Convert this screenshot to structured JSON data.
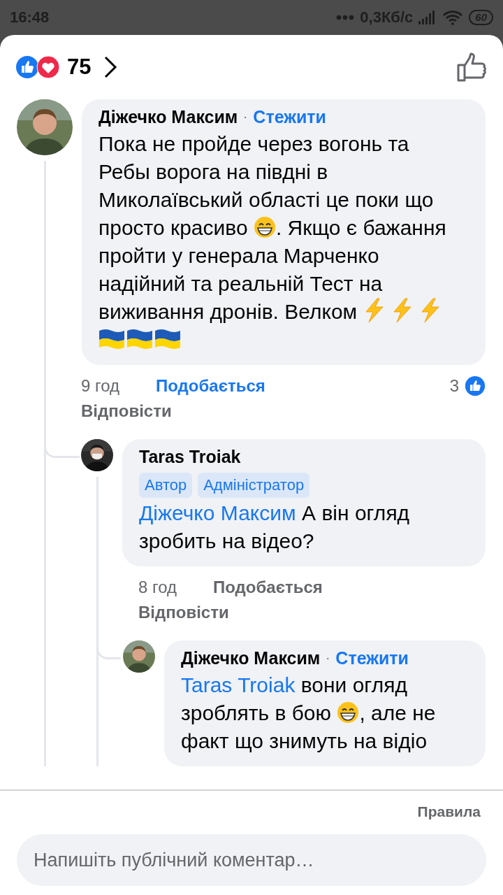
{
  "status_bar": {
    "time": "16:48",
    "net_speed": "0,3Кб/с",
    "battery": "60"
  },
  "header": {
    "reaction_count": "75"
  },
  "comments": [
    {
      "author": "Діжечко Максим",
      "separator": "·",
      "follow": "Стежити",
      "body": [
        {
          "kind": "text",
          "text": "Пока не пройде через вогонь та Ребы ворога на півдні в Миколаївський області це поки що просто красиво "
        },
        {
          "kind": "grin-emoji"
        },
        {
          "kind": "text",
          "text": ". Якщо є бажання пройти у генерала Марченко надійний та реальній Тест на виживання дронів. Велком "
        },
        {
          "kind": "lightning-emoji"
        },
        {
          "kind": "lightning-emoji"
        },
        {
          "kind": "lightning-emoji"
        },
        {
          "kind": "flag-emoji"
        },
        {
          "kind": "flag-emoji"
        },
        {
          "kind": "flag-emoji"
        }
      ],
      "time": "9 год",
      "like_label": "Подобається",
      "liked": true,
      "like_count": "3",
      "reply_label": "Відповісти",
      "replies": [
        {
          "author": "Taras Troiak",
          "badges": [
            "Автор",
            "Адміністратор"
          ],
          "body": [
            {
              "kind": "mention",
              "text": "Діжечко Максим"
            },
            {
              "kind": "text",
              "text": " А він огляд зробить на відео?"
            }
          ],
          "time": "8 год",
          "like_label": "Подобається",
          "liked": false,
          "reply_label": "Відповісти",
          "replies": [
            {
              "author": "Діжечко Максим",
              "separator": "·",
              "follow": "Стежити",
              "body": [
                {
                  "kind": "mention",
                  "text": "Taras Troiak"
                },
                {
                  "kind": "text",
                  "text": " вони огляд зроблять в бою "
                },
                {
                  "kind": "grin-emoji"
                },
                {
                  "kind": "text",
                  "text": ", але не факт що знимуть на відіо"
                }
              ]
            }
          ]
        }
      ]
    }
  ],
  "footer": {
    "rules": "Правила",
    "comment_field": {
      "placeholder": "Напишіть публічний коментар…"
    }
  }
}
